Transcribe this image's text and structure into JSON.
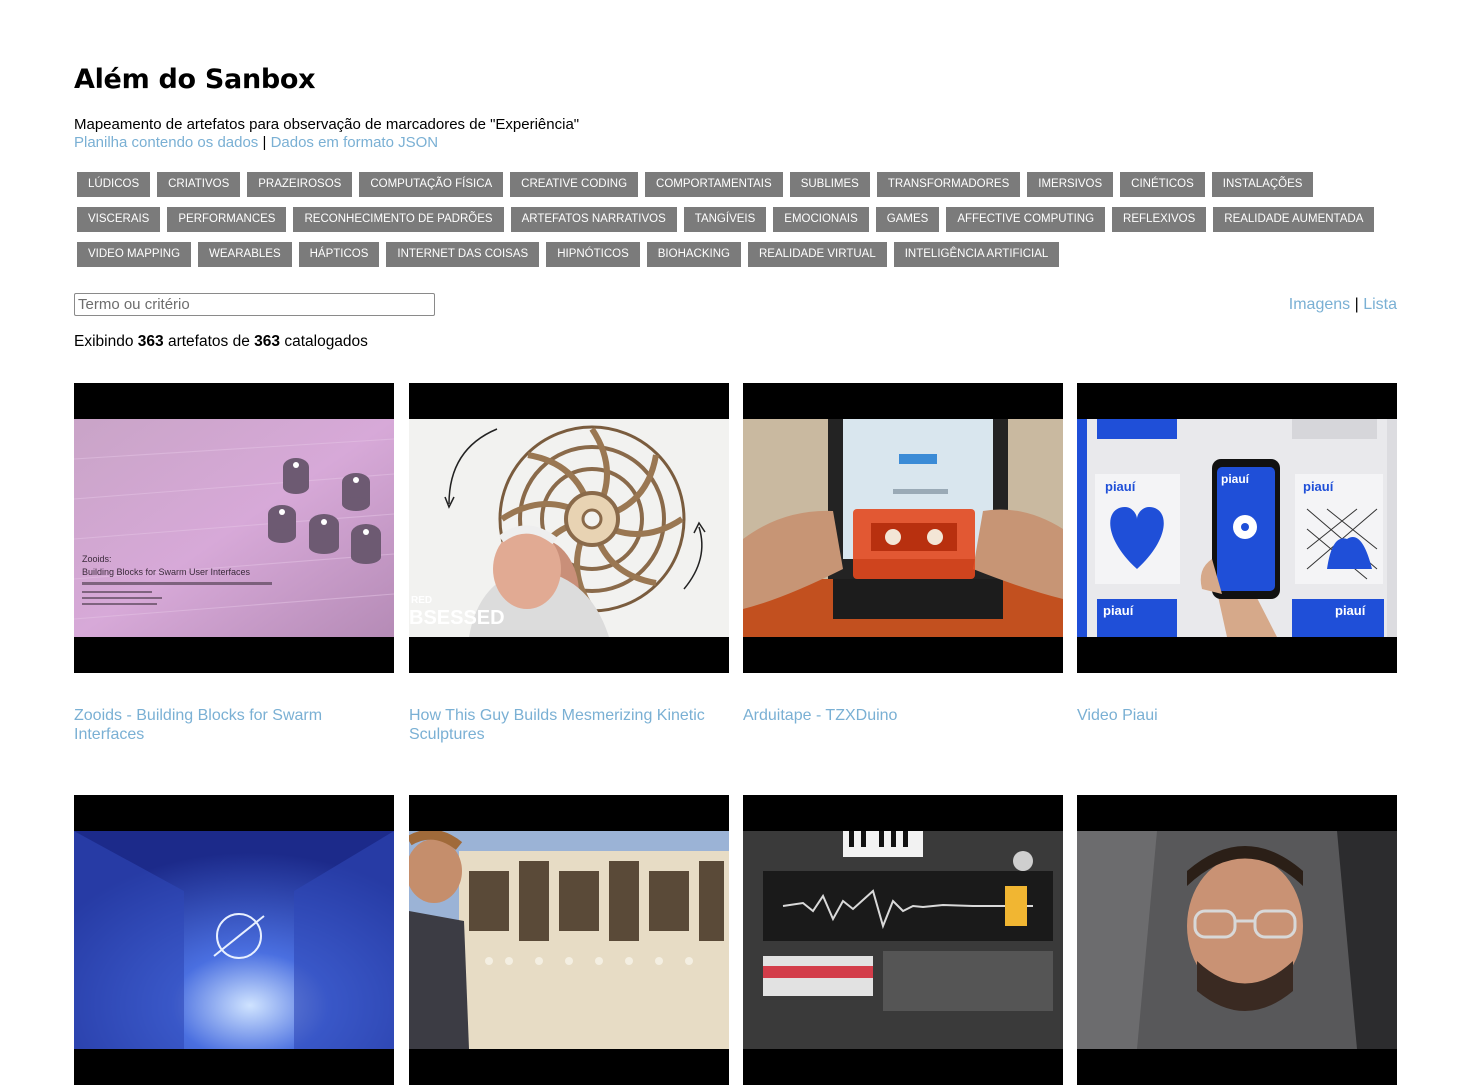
{
  "header": {
    "title": "Além do Sanbox",
    "subtitle": "Mapeamento de artefatos para observação de marcadores de \"Experiência\"",
    "link_spreadsheet": "Planilha contendo os dados",
    "separator": "|",
    "link_json": "Dados em formato JSON"
  },
  "tags": [
    "LÚDICOS",
    "CRIATIVOS",
    "PRAZEIROSOS",
    "COMPUTAÇÃO FÍSICA",
    "CREATIVE CODING",
    "COMPORTAMENTAIS",
    "SUBLIMES",
    "TRANSFORMADORES",
    "IMERSIVOS",
    "CINÉTICOS",
    "INSTALAÇÕES",
    "VISCERAIS",
    "PERFORMANCES",
    "RECONHECIMENTO DE PADRÕES",
    "ARTEFATOS NARRATIVOS",
    "TANGÍVEIS",
    "EMOCIONAIS",
    "GAMES",
    "AFFECTIVE COMPUTING",
    "REFLEXIVOS",
    "REALIDADE AUMENTADA",
    "VIDEO MAPPING",
    "WEARABLES",
    "HÁPTICOS",
    "INTERNET DAS COISAS",
    "HIPNÓTICOS",
    "BIOHACKING",
    "REALIDADE VIRTUAL",
    "INTELIGÊNCIA ARTIFICIAL"
  ],
  "search": {
    "placeholder": "Termo ou critério",
    "value": ""
  },
  "view_toggle": {
    "images": "Imagens",
    "separator": "|",
    "list": "Lista"
  },
  "count": {
    "prefix": "Exibindo",
    "shown": "363",
    "middle": "artefatos de",
    "total": "363",
    "suffix": "catalogados"
  },
  "cards": [
    {
      "title": "Zooids - Building Blocks for Swarm Interfaces",
      "thumb_text": [
        "Zooids:",
        "Building Blocks for Swarm User Interfaces"
      ]
    },
    {
      "title": "How This Guy Builds Mesmerizing Kinetic Sculptures",
      "thumb_text": [
        "RED",
        "BSESSED"
      ]
    },
    {
      "title": "Arduitape - TZXDuino"
    },
    {
      "title": "Video Piaui",
      "thumb_text": [
        "piauí",
        "piauí",
        "piauí",
        "piauí",
        "piauí"
      ]
    },
    {
      "title": ""
    },
    {
      "title": ""
    },
    {
      "title": ""
    },
    {
      "title": ""
    }
  ],
  "colors": {
    "link": "#7ab0d4",
    "tag_bg": "#7b7b7b",
    "tag_fg": "#ffffff",
    "piaui_blue": "#1f4fd8"
  }
}
